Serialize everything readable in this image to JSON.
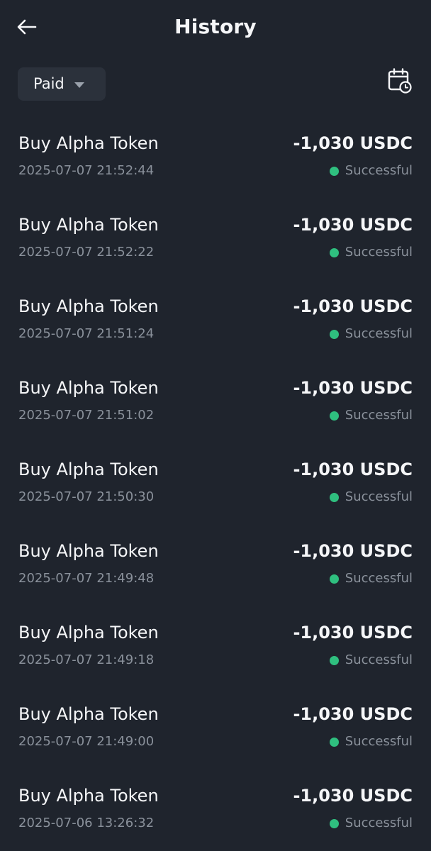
{
  "header": {
    "title": "History",
    "back_icon": "arrow-left-icon"
  },
  "filter": {
    "selected": "Paid",
    "calendar_icon": "calendar-clock-icon"
  },
  "colors": {
    "background": "#1f242d",
    "status_success": "#2fbf7f"
  },
  "transactions": [
    {
      "title": "Buy Alpha Token",
      "time": "2025-07-07 21:52:44",
      "amount": "-1,030 USDC",
      "status": "Successful"
    },
    {
      "title": "Buy Alpha Token",
      "time": "2025-07-07 21:52:22",
      "amount": "-1,030 USDC",
      "status": "Successful"
    },
    {
      "title": "Buy Alpha Token",
      "time": "2025-07-07 21:51:24",
      "amount": "-1,030 USDC",
      "status": "Successful"
    },
    {
      "title": "Buy Alpha Token",
      "time": "2025-07-07 21:51:02",
      "amount": "-1,030 USDC",
      "status": "Successful"
    },
    {
      "title": "Buy Alpha Token",
      "time": "2025-07-07 21:50:30",
      "amount": "-1,030 USDC",
      "status": "Successful"
    },
    {
      "title": "Buy Alpha Token",
      "time": "2025-07-07 21:49:48",
      "amount": "-1,030 USDC",
      "status": "Successful"
    },
    {
      "title": "Buy Alpha Token",
      "time": "2025-07-07 21:49:18",
      "amount": "-1,030 USDC",
      "status": "Successful"
    },
    {
      "title": "Buy Alpha Token",
      "time": "2025-07-07 21:49:00",
      "amount": "-1,030 USDC",
      "status": "Successful"
    },
    {
      "title": "Buy Alpha Token",
      "time": "2025-07-06 13:26:32",
      "amount": "-1,030 USDC",
      "status": "Successful"
    }
  ]
}
